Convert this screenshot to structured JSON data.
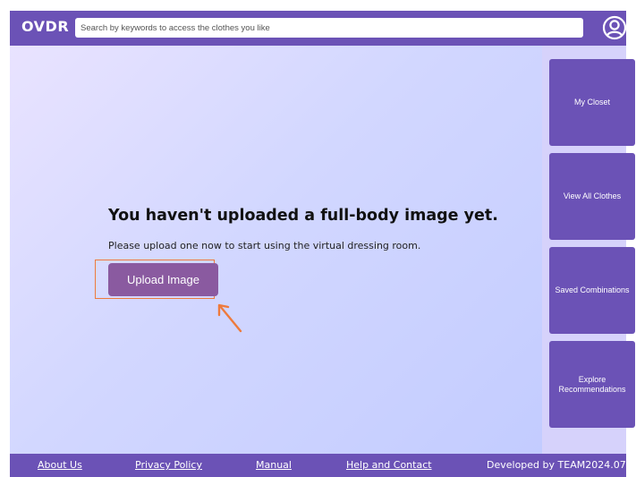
{
  "app": {
    "logo": "OVDR"
  },
  "search": {
    "placeholder": "Search by keywords to access the clothes you like"
  },
  "header": {
    "profile_icon": "user-circle-icon"
  },
  "main": {
    "headline": "You haven't uploaded a full-body image yet.",
    "subtext": "Please upload one now to start using the virtual dressing room.",
    "upload_label": "Upload Image"
  },
  "sidebar": {
    "items": [
      {
        "label": "My Closet"
      },
      {
        "label": "View All Clothes"
      },
      {
        "label": "Saved Combinations"
      },
      {
        "label": "Explore Recommendations"
      }
    ]
  },
  "footer": {
    "links": [
      "About Us",
      "Privacy Policy",
      "Manual",
      "Help and Contact"
    ],
    "credit": "Developed by TEAM2024.07"
  },
  "colors": {
    "brand": "#6b52b6",
    "highlight": "#ee7a3c",
    "upload_button": "#8a5aa0"
  }
}
